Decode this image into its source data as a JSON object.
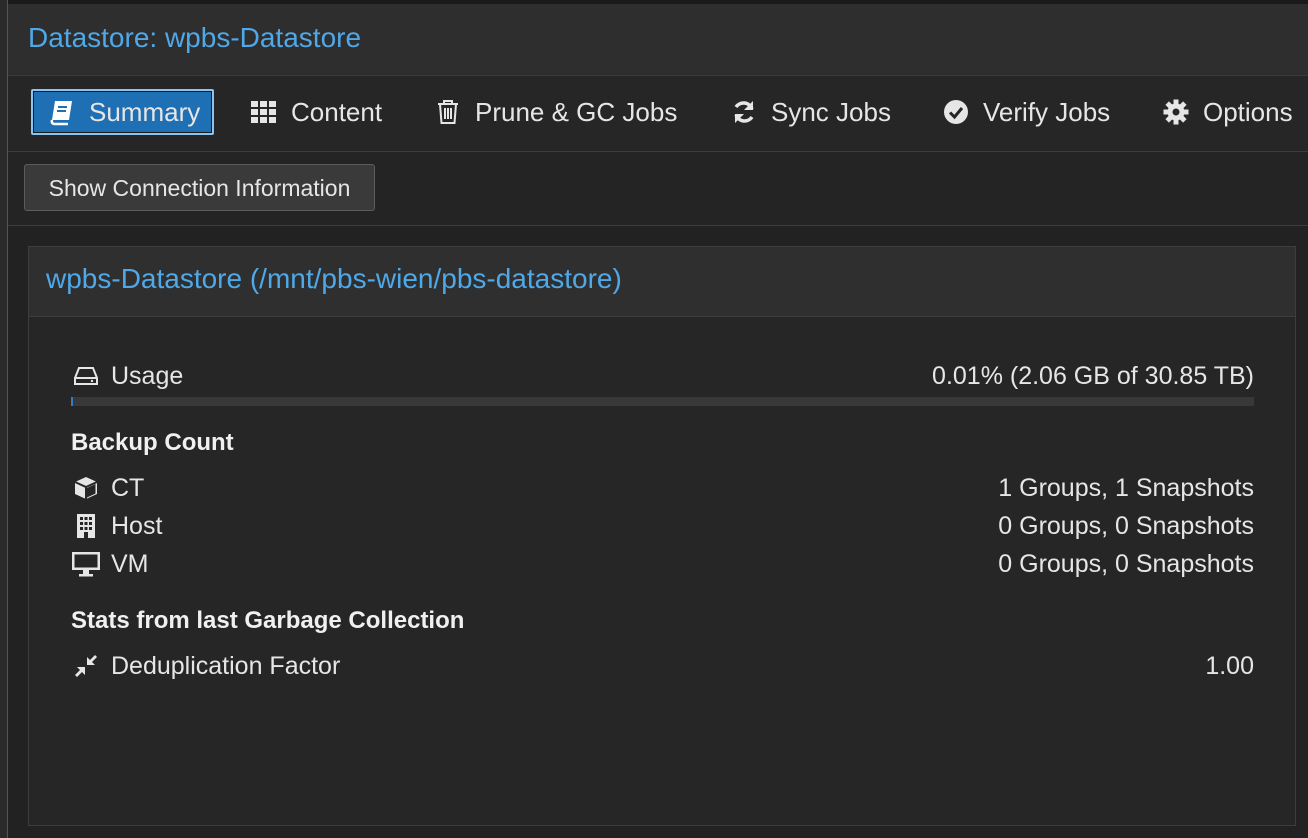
{
  "header": {
    "title": "Datastore: wpbs-Datastore"
  },
  "tabs": [
    {
      "label": "Summary",
      "icon": "book-icon",
      "active": true
    },
    {
      "label": "Content",
      "icon": "grid-icon",
      "active": false
    },
    {
      "label": "Prune & GC Jobs",
      "icon": "trash-icon",
      "active": false
    },
    {
      "label": "Sync Jobs",
      "icon": "refresh-icon",
      "active": false
    },
    {
      "label": "Verify Jobs",
      "icon": "check-circle-icon",
      "active": false
    },
    {
      "label": "Options",
      "icon": "gear-icon",
      "active": false
    }
  ],
  "toolbar": {
    "connection_button": "Show Connection Information"
  },
  "summary": {
    "title": "wpbs-Datastore (/mnt/pbs-wien/pbs-datastore)",
    "usage": {
      "label": "Usage",
      "value": "0.01% (2.06 GB of 30.85 TB)",
      "fraction": 0.0001,
      "icon": "hdd-icon"
    },
    "backup_count": {
      "heading": "Backup Count",
      "rows": [
        {
          "label": "CT",
          "value": "1 Groups, 1 Snapshots",
          "icon": "cube-icon"
        },
        {
          "label": "Host",
          "value": "0 Groups, 0 Snapshots",
          "icon": "building-icon"
        },
        {
          "label": "VM",
          "value": "0 Groups, 0 Snapshots",
          "icon": "desktop-icon"
        }
      ]
    },
    "gc_stats": {
      "heading": "Stats from last Garbage Collection",
      "rows": [
        {
          "label": "Deduplication Factor",
          "value": "1.00",
          "icon": "compress-icon"
        }
      ]
    }
  },
  "colors": {
    "accent": "#4fa8e8",
    "active_tab": "#1f6fb4",
    "usage_fill": "#2f7fc4"
  }
}
